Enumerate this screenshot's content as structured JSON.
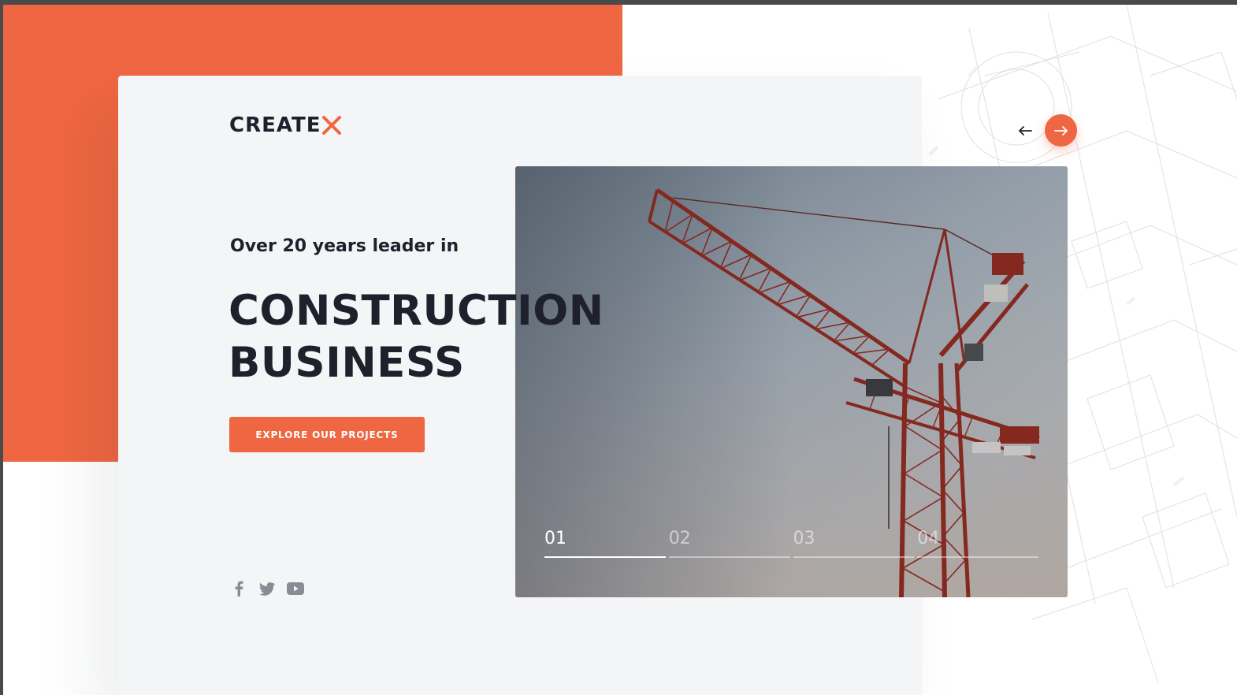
{
  "brand": {
    "logo_text": "CREATE",
    "logo_accent": "X",
    "accent_color": "#ef6642",
    "dark_color": "#1e212c"
  },
  "hero": {
    "tagline": "Over 20 years leader in",
    "headline_line1": "CONSTRUCTION",
    "headline_line2": "BUSINESS",
    "cta_label": "EXPLORE OUR PROJECTS"
  },
  "social": [
    {
      "name": "facebook",
      "icon": "facebook-icon"
    },
    {
      "name": "twitter",
      "icon": "twitter-icon"
    },
    {
      "name": "youtube",
      "icon": "youtube-icon"
    }
  ],
  "slider": {
    "nav": {
      "prev_icon": "arrow-left-icon",
      "next_icon": "arrow-right-icon"
    },
    "slides": [
      {
        "number": "01",
        "active": true
      },
      {
        "number": "02",
        "active": false
      },
      {
        "number": "03",
        "active": false
      },
      {
        "number": "04",
        "active": false
      }
    ],
    "image_subject": "tower-crane-photo"
  }
}
